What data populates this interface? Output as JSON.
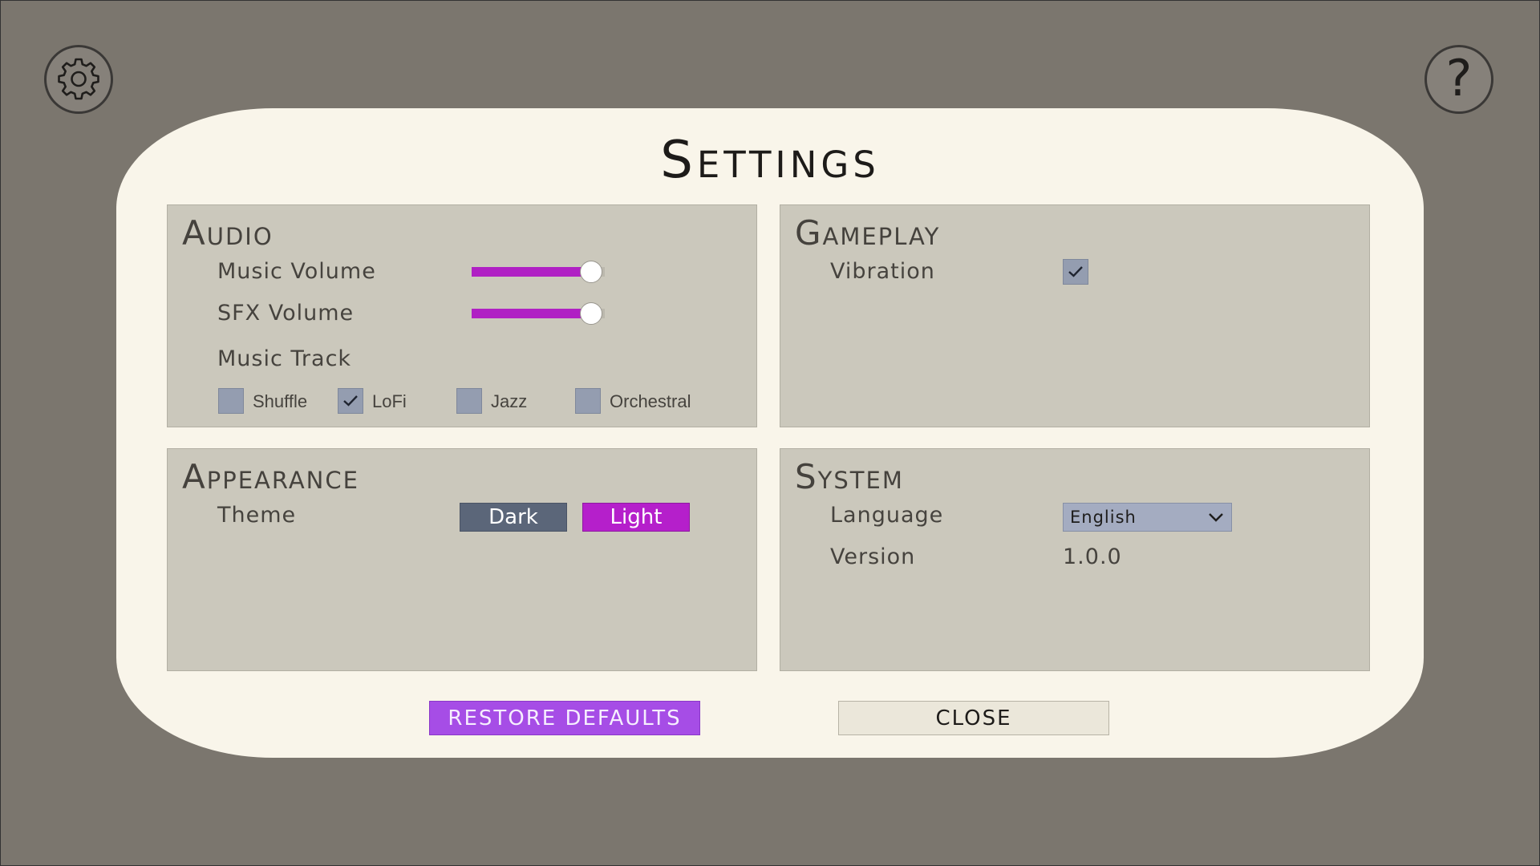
{
  "header": {
    "settings_icon": "gear-icon",
    "help_icon": "help-icon",
    "help_glyph": "?"
  },
  "dialog": {
    "title": "Settings"
  },
  "audio": {
    "title": "Audio",
    "music_volume_label": "Music Volume",
    "music_volume_level": 0.9,
    "sfx_volume_label": "SFX Volume",
    "sfx_volume_level": 0.9,
    "music_track_label": "Music Track",
    "tracks": [
      {
        "label": "Shuffle",
        "checked": false
      },
      {
        "label": "LoFi",
        "checked": true
      },
      {
        "label": "Jazz",
        "checked": false
      },
      {
        "label": "Orchestral",
        "checked": false
      }
    ]
  },
  "gameplay": {
    "title": "Gameplay",
    "vibration_label": "Vibration",
    "vibration_checked": true
  },
  "appearance": {
    "title": "Appearance",
    "theme_label": "Theme",
    "theme_options": [
      "Dark",
      "Light"
    ],
    "theme_selected": "Light"
  },
  "system": {
    "title": "System",
    "language_label": "Language",
    "language_value": "English",
    "version_label": "Version",
    "version_value": "1.0.0"
  },
  "actions": {
    "restore_label": "Restore Defaults",
    "close_label": "Close"
  },
  "colors": {
    "backdrop": "#7b766e",
    "panel": "#f9f5ea",
    "section": "#cbc8bc",
    "accent_magenta": "#b51fcb",
    "accent_purple": "#a64de6",
    "dark_theme": "#5b6679",
    "checkbox": "#949db0"
  }
}
